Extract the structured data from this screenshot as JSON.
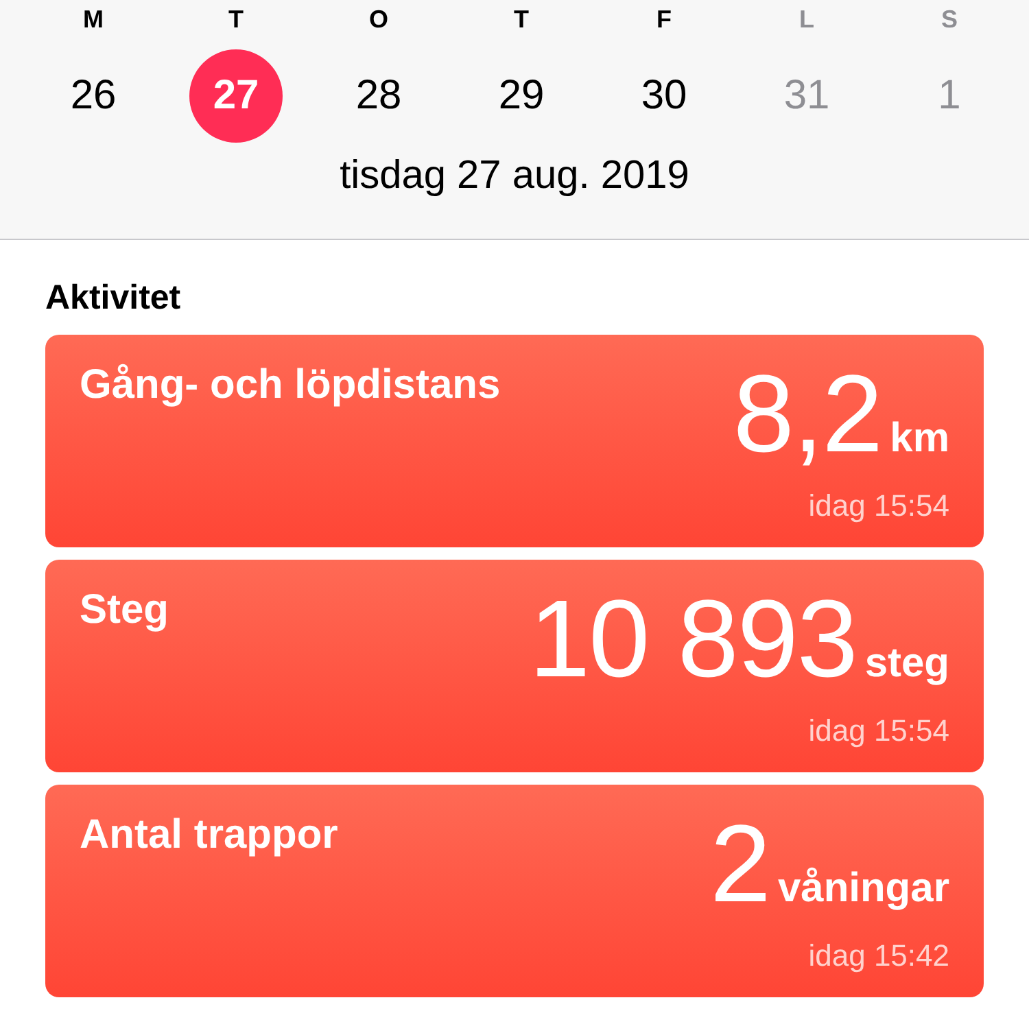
{
  "week": {
    "days": [
      {
        "weekday": "M",
        "date": "26",
        "selected": false,
        "dimmed": false
      },
      {
        "weekday": "T",
        "date": "27",
        "selected": true,
        "dimmed": false
      },
      {
        "weekday": "O",
        "date": "28",
        "selected": false,
        "dimmed": false
      },
      {
        "weekday": "T",
        "date": "29",
        "selected": false,
        "dimmed": false
      },
      {
        "weekday": "F",
        "date": "30",
        "selected": false,
        "dimmed": false
      },
      {
        "weekday": "L",
        "date": "31",
        "selected": false,
        "dimmed": true
      },
      {
        "weekday": "S",
        "date": "1",
        "selected": false,
        "dimmed": true
      }
    ],
    "full_date": "tisdag 27 aug. 2019"
  },
  "section": {
    "title": "Aktivitet",
    "cards": [
      {
        "title": "Gång- och löpdistans",
        "value": "8,2",
        "unit": "km",
        "time": "idag 15:54"
      },
      {
        "title": "Steg",
        "value": "10 893",
        "unit": "steg",
        "time": "idag 15:54"
      },
      {
        "title": "Antal trappor",
        "value": "2",
        "unit": "våningar",
        "time": "idag 15:42"
      }
    ]
  }
}
